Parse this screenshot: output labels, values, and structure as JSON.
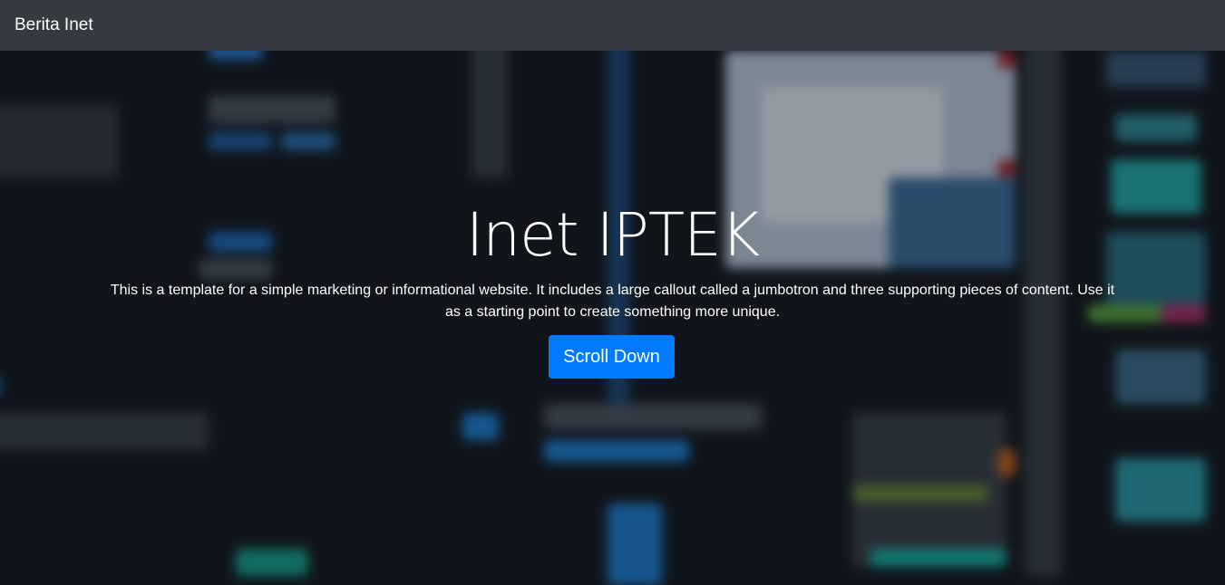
{
  "navbar": {
    "brand": "Berita Inet"
  },
  "hero": {
    "title": "Inet IPTEK",
    "lead": "This is a template for a simple marketing or informational website. It includes a large callout called a jumbotron and three supporting pieces of content. Use it as a starting point to create something more unique.",
    "button_label": "Scroll Down",
    "button_color": "#007bff",
    "background_image": "blurred-code-screen-photo"
  },
  "colors": {
    "navbar_bg": "#343a40",
    "text": "#ffffff"
  }
}
